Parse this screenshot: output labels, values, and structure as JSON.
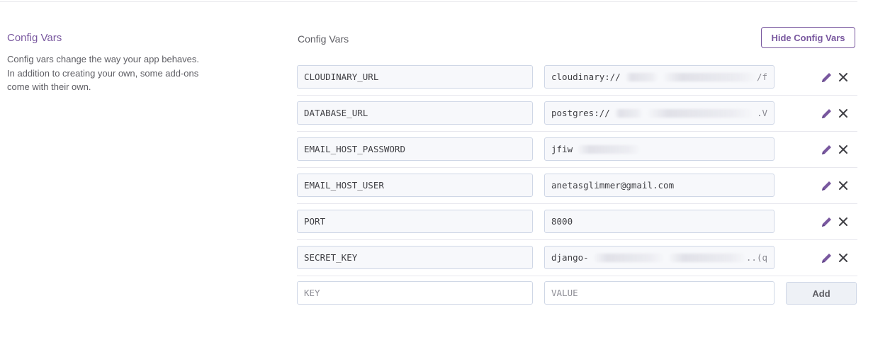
{
  "section": {
    "title": "Config Vars",
    "description": "Config vars change the way your app behaves. In addition to creating your own, some add-ons come with their own.",
    "list_label": "Config Vars",
    "hide_button": "Hide Config Vars"
  },
  "vars": [
    {
      "key": "CLOUDINARY_URL",
      "value_visible": "cloudinary://",
      "value_tail": "/f"
    },
    {
      "key": "DATABASE_URL",
      "value_visible": "postgres://",
      "value_tail": ".V"
    },
    {
      "key": "EMAIL_HOST_PASSWORD",
      "value_visible": "jfiw",
      "value_tail": ""
    },
    {
      "key": "EMAIL_HOST_USER",
      "value_visible": "anetasglimmer@gmail.com",
      "value_tail": ""
    },
    {
      "key": "PORT",
      "value_visible": "8000",
      "value_tail": ""
    },
    {
      "key": "SECRET_KEY",
      "value_visible": "django-",
      "value_tail": "..(q"
    }
  ],
  "new_var": {
    "key_placeholder": "KEY",
    "value_placeholder": "VALUE",
    "add_button": "Add"
  },
  "colors": {
    "accent": "#79589f",
    "icon": "#3f3f44",
    "border": "#cfd7e6"
  },
  "icons": {
    "edit": "pencil-icon",
    "delete": "close-icon"
  }
}
